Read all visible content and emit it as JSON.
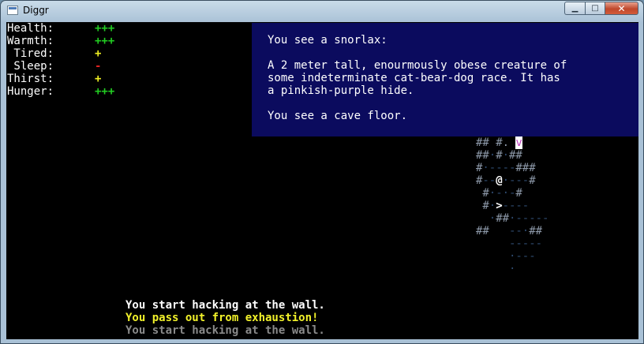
{
  "window": {
    "title": "Diggr",
    "minimize_glyph": "▁",
    "maximize_glyph": "□",
    "close_glyph": "✕"
  },
  "stats": [
    {
      "label": "Health:",
      "value": "+++",
      "color": "#22cc22"
    },
    {
      "label": "Warmth:",
      "value": "+++",
      "color": "#22cc22"
    },
    {
      "label": " Tired:",
      "value": "+",
      "color": "#eeee22"
    },
    {
      "label": " Sleep:",
      "value": "-",
      "color": "#dd2222"
    },
    {
      "label": "Thirst:",
      "value": "+",
      "color": "#eeee22"
    },
    {
      "label": "Hunger:",
      "value": "+++",
      "color": "#22cc22"
    }
  ],
  "info_panel": {
    "lines": [
      "You see a snorlax:",
      "A 2 meter tall, enourmously obese creature of",
      "some indeterminate cat-bear-dog race. It has",
      "a pinkish-purple hide.",
      "You see a cave floor."
    ],
    "background": "#0b0b5e"
  },
  "map": {
    "wall_color": "#8c98a8",
    "floor_color": "#2e4a6e",
    "player_glyph": "@",
    "stairs_glyph": ">",
    "monster_glyph": "v",
    "monster_color": "#c040c0",
    "rows": [
      "## #. v",
      "##·#·##",
      "#·----###",
      "#--@·---#",
      " #·-·-#",
      " #·>----",
      "  ·##·-----",
      "##   --·##",
      "     -----",
      "     ·---",
      "     ·"
    ]
  },
  "messages": [
    {
      "text": "You start hacking at the wall.",
      "color": "#ffffff"
    },
    {
      "text": "You pass out from exhaustion!",
      "color": "#f2f22a"
    },
    {
      "text": "You start hacking at the wall.",
      "color": "#8a8a8a"
    }
  ]
}
